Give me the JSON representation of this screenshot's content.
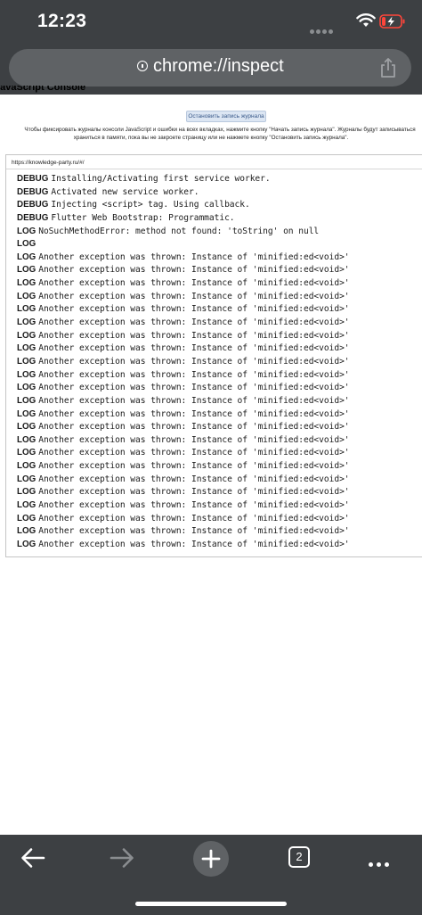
{
  "status_bar": {
    "time": "12:23"
  },
  "url_bar": {
    "url": "chrome://inspect"
  },
  "page": {
    "title": "JavaScript Console",
    "stop_button_label": "Остановить запись журнала",
    "description_line1": "Чтобы фиксировать журналы консоли JavaScript и ошибки на всех вкладках, нажмите кнопку \"Начать запись журнала\". Журналы будут записываться",
    "description_line2": "храниться в памяти, пока вы не закроете страницу или не нажмете кнопку \"Остановить запись журнала\"."
  },
  "console": {
    "source_url": "https://knowledge-party.ru/#/",
    "entries": [
      {
        "level": "DEBUG",
        "message": "Installing/Activating first service worker."
      },
      {
        "level": "DEBUG",
        "message": "Activated new service worker."
      },
      {
        "level": "DEBUG",
        "message": "Injecting <script> tag. Using callback."
      },
      {
        "level": "DEBUG",
        "message": "Flutter Web Bootstrap: Programmatic."
      },
      {
        "level": "LOG",
        "message": "NoSuchMethodError: method not found: 'toString' on null"
      },
      {
        "level": "LOG",
        "message": ""
      },
      {
        "level": "LOG",
        "message": "Another exception was thrown: Instance of 'minified:ed<void>'"
      },
      {
        "level": "LOG",
        "message": "Another exception was thrown: Instance of 'minified:ed<void>'"
      },
      {
        "level": "LOG",
        "message": "Another exception was thrown: Instance of 'minified:ed<void>'"
      },
      {
        "level": "LOG",
        "message": "Another exception was thrown: Instance of 'minified:ed<void>'"
      },
      {
        "level": "LOG",
        "message": "Another exception was thrown: Instance of 'minified:ed<void>'"
      },
      {
        "level": "LOG",
        "message": "Another exception was thrown: Instance of 'minified:ed<void>'"
      },
      {
        "level": "LOG",
        "message": "Another exception was thrown: Instance of 'minified:ed<void>'"
      },
      {
        "level": "LOG",
        "message": "Another exception was thrown: Instance of 'minified:ed<void>'"
      },
      {
        "level": "LOG",
        "message": "Another exception was thrown: Instance of 'minified:ed<void>'"
      },
      {
        "level": "LOG",
        "message": "Another exception was thrown: Instance of 'minified:ed<void>'"
      },
      {
        "level": "LOG",
        "message": "Another exception was thrown: Instance of 'minified:ed<void>'"
      },
      {
        "level": "LOG",
        "message": "Another exception was thrown: Instance of 'minified:ed<void>'"
      },
      {
        "level": "LOG",
        "message": "Another exception was thrown: Instance of 'minified:ed<void>'"
      },
      {
        "level": "LOG",
        "message": "Another exception was thrown: Instance of 'minified:ed<void>'"
      },
      {
        "level": "LOG",
        "message": "Another exception was thrown: Instance of 'minified:ed<void>'"
      },
      {
        "level": "LOG",
        "message": "Another exception was thrown: Instance of 'minified:ed<void>'"
      },
      {
        "level": "LOG",
        "message": "Another exception was thrown: Instance of 'minified:ed<void>'"
      },
      {
        "level": "LOG",
        "message": "Another exception was thrown: Instance of 'minified:ed<void>'"
      },
      {
        "level": "LOG",
        "message": "Another exception was thrown: Instance of 'minified:ed<void>'"
      },
      {
        "level": "LOG",
        "message": "Another exception was thrown: Instance of 'minified:ed<void>'"
      },
      {
        "level": "LOG",
        "message": "Another exception was thrown: Instance of 'minified:ed<void>'"
      },
      {
        "level": "LOG",
        "message": "Another exception was thrown: Instance of 'minified:ed<void>'"
      },
      {
        "level": "LOG",
        "message": "Another exception was thrown: Instance of 'minified:ed<void>'"
      }
    ]
  },
  "toolbar": {
    "tab_count": "2"
  },
  "colors": {
    "chrome_bar": "#3d4043",
    "url_field": "#5f6265",
    "battery_low": "#ff453a"
  },
  "icons": [
    "info-icon",
    "share-icon",
    "back-arrow-icon",
    "forward-arrow-icon",
    "plus-icon",
    "tabs-icon",
    "more-icon",
    "wifi-icon",
    "battery-icon"
  ]
}
